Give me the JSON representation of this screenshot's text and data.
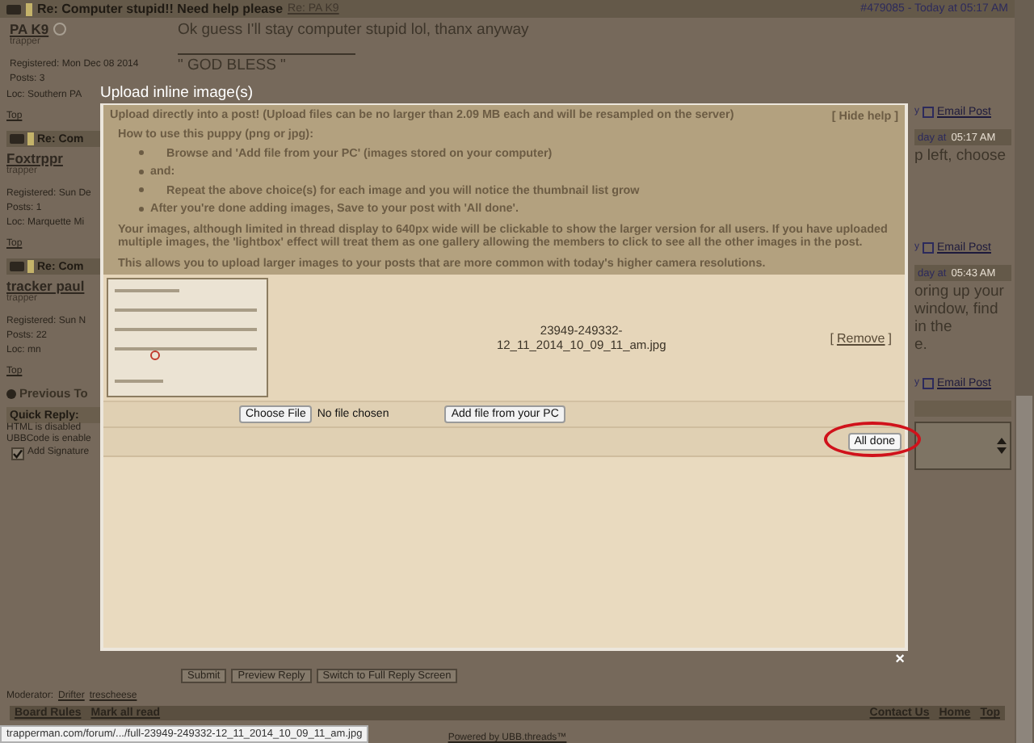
{
  "top_post": {
    "title": "Re: Computer stupid!! Need help please",
    "reply_to": "Re: PA K9",
    "meta": "#479085 - Today at 05:17 AM",
    "author": "PA K9",
    "rank": "trapper",
    "registered": "Registered: Mon Dec 08 2014",
    "posts": "Posts: 3",
    "message": "Ok guess I'll stay computer stupid lol, thanx anyway",
    "signature": "\" GOD BLESS \""
  },
  "left_column": [
    {
      "kind": "text",
      "text": "Loc: Southern PA"
    },
    {
      "kind": "link",
      "text": "Top"
    },
    {
      "kind": "header",
      "text": "Re: Com"
    },
    {
      "kind": "user",
      "text": "Foxtrppr"
    },
    {
      "kind": "rank",
      "text": "trapper"
    },
    {
      "kind": "registered",
      "text": "Registered: Sun De"
    },
    {
      "kind": "text",
      "text": "Posts: 1"
    },
    {
      "kind": "text",
      "text": "Loc: Marquette Mi"
    },
    {
      "kind": "link",
      "text": "Top"
    },
    {
      "kind": "header",
      "text": "Re: Com"
    },
    {
      "kind": "user",
      "text": "tracker paul"
    },
    {
      "kind": "rank",
      "text": "trapper"
    },
    {
      "kind": "registered",
      "text": "Registered: Sun N"
    },
    {
      "kind": "text",
      "text": "Posts: 22"
    },
    {
      "kind": "text",
      "text": "Loc: mn"
    },
    {
      "kind": "link",
      "text": "Top"
    },
    {
      "kind": "section",
      "text": "Previous To"
    },
    {
      "kind": "bar",
      "text": "Quick Reply:"
    },
    {
      "kind": "note",
      "text": "HTML is disabled"
    },
    {
      "kind": "note",
      "text": "UBBCode is enable"
    },
    {
      "kind": "checkbox",
      "text": "Add Signature",
      "checked": true
    }
  ],
  "right_column": [
    {
      "kind": "email",
      "prefix": "y",
      "text": "Email Post"
    },
    {
      "kind": "header",
      "text": "day at",
      "time": "05:17 AM"
    },
    {
      "kind": "message",
      "lines": [
        "p left, choose"
      ]
    },
    {
      "kind": "email",
      "prefix": "y",
      "text": "Email Post"
    },
    {
      "kind": "header",
      "text": "day at",
      "time": "05:43 AM"
    },
    {
      "kind": "message",
      "lines": [
        "oring up your",
        "window, find",
        "in the",
        "e."
      ]
    },
    {
      "kind": "email",
      "prefix": "y",
      "text": "Email Post"
    },
    {
      "kind": "bar"
    },
    {
      "kind": "textarea"
    }
  ],
  "dialog": {
    "title": "Upload inline image(s)",
    "help_heading": "Upload directly into a post! (Upload files can be no larger than 2.09 MB each and will be resampled on the server)",
    "hide_help": "[ Hide help ]",
    "howto": "How to use this puppy (png or jpg):",
    "steps": [
      {
        "kind": "indented",
        "text": "Browse and 'Add file from your PC' (images stored on your computer)"
      },
      {
        "kind": "plain",
        "text": "and:"
      },
      {
        "kind": "indented",
        "text": "Repeat the above choice(s) for each image and you will notice the thumbnail list grow"
      },
      {
        "kind": "plain",
        "text": "After you're done adding images, Save to your post with 'All done'."
      }
    ],
    "paragraphs": [
      "Your images, although limited in thread display to 640px wide will be clickable to show the larger version for all users. If you have uploaded multiple images, the 'lightbox' effect will treat them as one gallery allowing the members to click to see all the other images in the post.",
      "This allows you to upload larger images to your posts that are more common with today's higher camera resolutions."
    ],
    "file_name": [
      "23949-249332-",
      "12_11_2014_10_09_11_am.jpg"
    ],
    "remove_open": "[",
    "remove": "Remove",
    "remove_close": "]",
    "choose_button": "Choose File",
    "no_file": "No file chosen",
    "add_button": "Add file from your PC",
    "done_button": "All done",
    "close": "×"
  },
  "reply_buttons": [
    "Submit",
    "Preview Reply",
    "Switch to Full Reply Screen"
  ],
  "moderator": {
    "label": "Moderator:",
    "names": [
      "Drifter",
      "trescheese"
    ]
  },
  "footer_bar": {
    "left": [
      "Board Rules",
      "Mark all read"
    ],
    "right": [
      "Contact Us",
      "Home",
      "Top"
    ]
  },
  "powered": "Powered by UBB.threads™",
  "status_url": "trapperman.com/forum/.../full-23949-249332-12_11_2014_10_09_11_am.jpg"
}
